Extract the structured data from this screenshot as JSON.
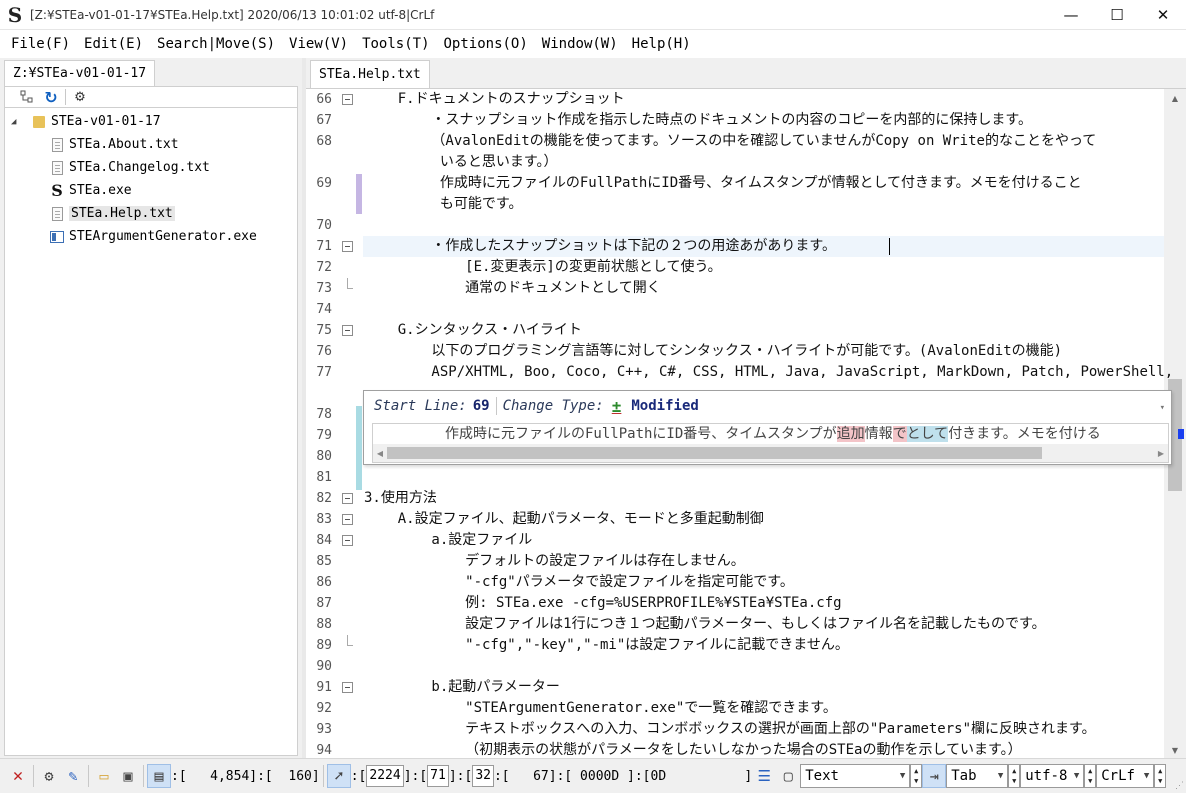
{
  "window": {
    "title": "[Z:¥STEa-v01-01-17¥STEa.Help.txt] 2020/06/13 10:01:02 utf-8|CrLf",
    "app_icon": "S",
    "minimize": "—",
    "maximize": "☐",
    "close": "✕"
  },
  "menu": [
    "File(F)",
    "Edit(E)",
    "Search|Move(S)",
    "View(V)",
    "Tools(T)",
    "Options(O)",
    "Window(W)",
    "Help(H)"
  ],
  "explorer": {
    "tab": "Z:¥STEa-v01-01-17",
    "toolbar_icons": [
      "tree-layout-icon",
      "refresh-icon",
      "gear-icon"
    ],
    "tree": [
      {
        "label": "STEa-v01-01-17",
        "type": "folder",
        "level": 0
      },
      {
        "label": "STEa.About.txt",
        "type": "text",
        "level": 1
      },
      {
        "label": "STEa.Changelog.txt",
        "type": "text",
        "level": 1
      },
      {
        "label": "STEa.exe",
        "type": "app",
        "level": 1
      },
      {
        "label": "STEa.Help.txt",
        "type": "text",
        "level": 1,
        "selected": true
      },
      {
        "label": "STEArgumentGenerator.exe",
        "type": "exe",
        "level": 1
      }
    ]
  },
  "editor": {
    "tab": "STEa.Help.txt",
    "lines": [
      {
        "n": "66",
        "fold": "box",
        "text": "    F.ドキュメントのスナップショット"
      },
      {
        "n": "67",
        "fold": "line",
        "text": "        ・スナップショット作成を指示した時点のドキュメントの内容のコピーを内部的に保持します。"
      },
      {
        "n": "68",
        "fold": "line",
        "text": "        （AvalonEditの機能を使ってます。ソースの中を確認していませんがCopy on Write的なことをやって"
      },
      {
        "n": "",
        "fold": "line",
        "text": "         いると思います。）"
      },
      {
        "n": "69",
        "fold": "line",
        "text": "         作成時に元ファイルのFullPathにID番号、タイムスタンプが情報として付きます。メモを付けること"
      },
      {
        "n": "",
        "fold": "line",
        "text": "         も可能です。"
      },
      {
        "n": "70",
        "fold": "line",
        "text": ""
      },
      {
        "n": "71",
        "fold": "box",
        "text": "        ・作成したスナップショットは下記の２つの用途あがあります。"
      },
      {
        "n": "72",
        "fold": "line",
        "text": "            [E.変更表示]の変更前状態として使う。"
      },
      {
        "n": "73",
        "fold": "end",
        "text": "            通常のドキュメントとして開く"
      },
      {
        "n": "74",
        "fold": "line",
        "text": ""
      },
      {
        "n": "75",
        "fold": "box",
        "text": "    G.シンタックス・ハイライト"
      },
      {
        "n": "76",
        "fold": "line",
        "text": "        以下のプログラミング言語等に対してシンタックス・ハイライトが可能です。(AvalonEditの機能)"
      },
      {
        "n": "77",
        "fold": "line",
        "text": "        ASP/XHTML, Boo, Coco, C++, C#, CSS, HTML, Java, JavaScript, MarkDown, Patch, PowerShell,"
      },
      {
        "n": "",
        "fold": "line",
        "text": ""
      },
      {
        "n": "78",
        "fold": "line",
        "text": ""
      },
      {
        "n": "79",
        "fold": "line",
        "text": ""
      },
      {
        "n": "80",
        "fold": "line",
        "text": ""
      },
      {
        "n": "81",
        "fold": "line",
        "text": ""
      },
      {
        "n": "82",
        "fold": "box",
        "text": "3.使用方法"
      },
      {
        "n": "83",
        "fold": "box",
        "text": "    A.設定ファイル、起動パラメータ、モードと多重起動制御"
      },
      {
        "n": "84",
        "fold": "box",
        "text": "        a.設定ファイル"
      },
      {
        "n": "85",
        "fold": "line",
        "text": "            デフォルトの設定ファイルは存在しません。"
      },
      {
        "n": "86",
        "fold": "line",
        "text": "            \"-cfg\"パラメータで設定ファイルを指定可能です。"
      },
      {
        "n": "87",
        "fold": "line",
        "text": "            例: STEa.exe -cfg=%USERPROFILE%¥STEa¥STEa.cfg"
      },
      {
        "n": "88",
        "fold": "line",
        "text": "            設定ファイルは1行につき１つ起動パラメーター、もしくはファイル名を記載したものです。"
      },
      {
        "n": "89",
        "fold": "end",
        "text": "            \"-cfg\",\"-key\",\"-mi\"は設定ファイルに記載できません。"
      },
      {
        "n": "90",
        "fold": "line",
        "text": ""
      },
      {
        "n": "91",
        "fold": "box",
        "text": "        b.起動パラメーター"
      },
      {
        "n": "92",
        "fold": "line",
        "text": "            \"STEArgumentGenerator.exe\"で一覧を確認できます。"
      },
      {
        "n": "93",
        "fold": "line",
        "text": "            テキストボックスへの入力、コンボボックスの選択が画面上部の\"Parameters\"欄に反映されます。"
      },
      {
        "n": "94",
        "fold": "line",
        "text": "            （初期表示の状態がパラメータをしたいしなかった場合のSTEaの動作を示しています。）"
      }
    ]
  },
  "change_popup": {
    "start_line_label": "Start Line:",
    "start_line_value": "69",
    "change_type_label": "Change Type:",
    "change_type_symbol": "±",
    "change_type_value": "Modified",
    "preview_segments": [
      {
        "text": "作成時に元ファイルのFullPathにID番号、タイムスタンプが",
        "hl": ""
      },
      {
        "text": "追加",
        "hl": "red"
      },
      {
        "text": "情報",
        "hl": ""
      },
      {
        "text": "で",
        "hl": "red"
      },
      {
        "text": "として",
        "hl": "blue"
      },
      {
        "text": "付きます。メモを付ける",
        "hl": ""
      }
    ]
  },
  "statusbar": {
    "pos1": ":[   4,854]:[  160]",
    "pos2_a": "2224",
    "pos2_b": "71",
    "pos2_c": "32",
    "pos2_d": ":[   67]:[ 0000D ]:[0D          ]",
    "syntax": "Text",
    "indent": "Tab",
    "encoding": "utf-8",
    "eol": "CrLf"
  }
}
